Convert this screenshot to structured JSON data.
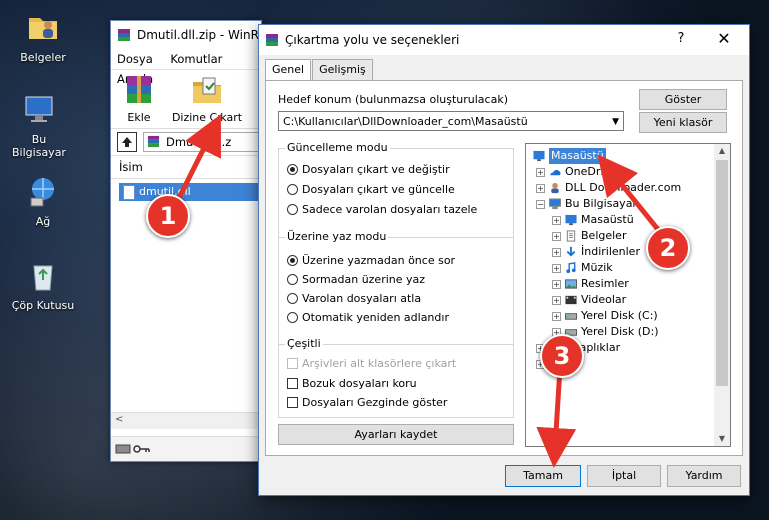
{
  "desktop": {
    "icons": [
      {
        "label": "Belgeler",
        "icon": "folder-user-icon"
      },
      {
        "label": "Bu Bilgisayar",
        "icon": "computer-icon"
      },
      {
        "label": "Ağ",
        "icon": "network-icon"
      },
      {
        "label": "Çöp Kutusu",
        "icon": "recycle-bin-icon"
      }
    ]
  },
  "winrar": {
    "title": "Dmutil.dll.zip - WinR",
    "menu": [
      "Dosya",
      "Komutlar",
      "Araçla"
    ],
    "toolbar": {
      "add_label": "Ekle",
      "extract_label": "Dizine Çıkart"
    },
    "address": "Dmutil.dll.z",
    "list_header": "İsim",
    "file_name": "dmutil.dll"
  },
  "dialog": {
    "title": "Çıkartma yolu ve seçenekleri",
    "help": "?",
    "close": "✕",
    "tabs": [
      "Genel",
      "Gelişmiş"
    ],
    "dest_label": "Hedef konum (bulunmazsa oluşturulacak)",
    "dest_value": "C:\\Kullanıcılar\\DllDownloader_com\\Masaüstü",
    "show_button": "Göster",
    "new_folder_button": "Yeni klasör",
    "update_mode": {
      "title": "Güncelleme modu",
      "options": [
        "Dosyaları çıkart ve değiştir",
        "Dosyaları çıkart ve güncelle",
        "Sadece varolan dosyaları tazele"
      ],
      "selected": 0
    },
    "overwrite_mode": {
      "title": "Üzerine yaz modu",
      "options": [
        "Üzerine yazmadan önce sor",
        "Sormadan üzerine yaz",
        "Varolan dosyaları atla",
        "Otomatik yeniden adlandır"
      ],
      "selected": 0
    },
    "misc": {
      "title": "Çeşitli",
      "options": [
        "Arşivleri alt klasörlere çıkart",
        "Bozuk dosyaları koru",
        "Dosyaları Gezginde göster"
      ],
      "disabled": [
        true,
        false,
        false
      ],
      "checked": [
        false,
        false,
        false
      ]
    },
    "save_button": "Ayarları kaydet",
    "tree": [
      {
        "label": "Masaüstü",
        "level": 0,
        "expander": "",
        "icon": "desktop-icon",
        "selected": true
      },
      {
        "label": "OneDrive",
        "level": 1,
        "expander": "+",
        "icon": "onedrive-icon"
      },
      {
        "label": "DLL Downloader.com",
        "level": 1,
        "expander": "+",
        "icon": "user-icon"
      },
      {
        "label": "Bu Bilgisayar",
        "level": 1,
        "expander": "−",
        "icon": "computer-icon"
      },
      {
        "label": "Masaüstü",
        "level": 2,
        "expander": "+",
        "icon": "desktop-icon"
      },
      {
        "label": "Belgeler",
        "level": 2,
        "expander": "+",
        "icon": "documents-icon"
      },
      {
        "label": "İndirilenler",
        "level": 2,
        "expander": "+",
        "icon": "downloads-icon"
      },
      {
        "label": "Müzik",
        "level": 2,
        "expander": "+",
        "icon": "music-icon"
      },
      {
        "label": "Resimler",
        "level": 2,
        "expander": "+",
        "icon": "pictures-icon"
      },
      {
        "label": "Videolar",
        "level": 2,
        "expander": "+",
        "icon": "videos-icon"
      },
      {
        "label": "Yerel Disk (C:)",
        "level": 2,
        "expander": "+",
        "icon": "disk-icon"
      },
      {
        "label": "Yerel Disk (D:)",
        "level": 2,
        "expander": "+",
        "icon": "disk-icon"
      },
      {
        "label": "Kitaplıklar",
        "level": 1,
        "expander": "+",
        "icon": "library-icon"
      },
      {
        "label": "Ağ",
        "level": 1,
        "expander": "+",
        "icon": "network-icon"
      }
    ],
    "ok_button": "Tamam",
    "cancel_button": "İptal",
    "help_button": "Yardım"
  },
  "annotations": [
    "1",
    "2",
    "3"
  ],
  "colors": {
    "annotation": "#e5332a",
    "selection": "#3d83d6"
  }
}
